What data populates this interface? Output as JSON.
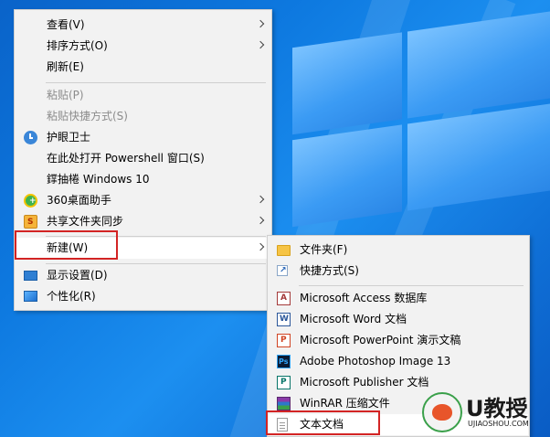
{
  "context_menu": {
    "items": [
      {
        "label": "查看(V)",
        "submenu": true
      },
      {
        "label": "排序方式(O)",
        "submenu": true
      },
      {
        "label": "刷新(E)"
      },
      {
        "label": "粘贴(P)",
        "disabled": true
      },
      {
        "label": "粘贴快捷方式(S)",
        "disabled": true
      },
      {
        "label": "护眼卫士",
        "icon": "clock-icon"
      },
      {
        "label": "在此处打开 Powershell 窗口(S)"
      },
      {
        "label": "鐣抽棬 Windows 10"
      },
      {
        "label": "360桌面助手",
        "icon": "360-icon",
        "submenu": true
      },
      {
        "label": "共享文件夹同步",
        "icon": "sync-folder-icon",
        "submenu": true
      },
      {
        "label": "新建(W)",
        "submenu": true,
        "highlighted": true
      },
      {
        "label": "显示设置(D)",
        "icon": "display-icon"
      },
      {
        "label": "个性化(R)",
        "icon": "personalize-icon"
      }
    ]
  },
  "new_submenu": {
    "items": [
      {
        "label": "文件夹(F)",
        "icon": "folder-icon"
      },
      {
        "label": "快捷方式(S)",
        "icon": "shortcut-icon"
      },
      {
        "label": "Microsoft Access 数据库",
        "icon": "access-icon"
      },
      {
        "label": "Microsoft Word 文档",
        "icon": "word-icon"
      },
      {
        "label": "Microsoft PowerPoint 演示文稿",
        "icon": "powerpoint-icon"
      },
      {
        "label": "Adobe Photoshop Image 13",
        "icon": "photoshop-icon"
      },
      {
        "label": "Microsoft Publisher 文档",
        "icon": "publisher-icon"
      },
      {
        "label": "WinRAR 压缩文件",
        "icon": "winrar-icon"
      },
      {
        "label": "文本文档",
        "icon": "text-document-icon",
        "highlighted": true
      }
    ]
  },
  "watermark": {
    "text": "U教授",
    "url_text": "UJIAOSHOU.COM"
  },
  "colors": {
    "menu_bg": "#f2f2f2",
    "highlight_box": "#d32424",
    "desktop": "#0d78df"
  }
}
